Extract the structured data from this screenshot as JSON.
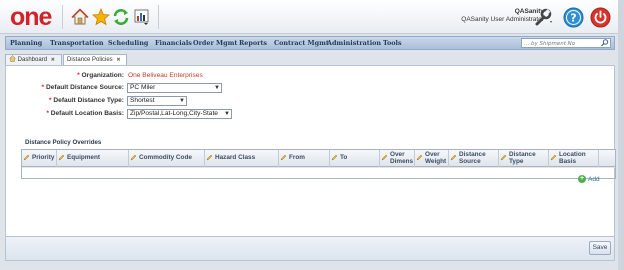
{
  "header": {
    "logo_text": "one",
    "user_name": "QASanity",
    "user_role": "QASanity User Administrator",
    "icons": [
      "home-icon",
      "star-icon",
      "refresh-icon",
      "report-icon",
      "wrench-icon",
      "help-icon",
      "power-icon"
    ]
  },
  "nav": {
    "items": [
      "Planning",
      "Transportation",
      "Scheduling",
      "Financials",
      "Order Mgmt",
      "Reports",
      "Contract Mgmt",
      "Administration",
      "Tools"
    ],
    "search_placeholder": "... by Shipment No"
  },
  "tabs": [
    {
      "label": "Dashboard"
    },
    {
      "label": "Distance Policies"
    }
  ],
  "form": {
    "organization_label": "Organization:",
    "organization_value": "One Beliveau Enterprises",
    "distance_source_label": "Default Distance Source:",
    "distance_source_value": "PC Miler",
    "distance_type_label": "Default Distance Type:",
    "distance_type_value": "Shortest",
    "location_basis_label": "Default Location Basis:",
    "location_basis_value": "Zip/Postal,Lat-Long,City-State"
  },
  "overrides": {
    "title": "Distance Policy Overrides",
    "columns": [
      "Priority",
      "Equipment",
      "Commodity Code",
      "Hazard Class",
      "From",
      "To",
      "Over Dimens",
      "Over Weight",
      "Distance Source",
      "Distance Type",
      "Location Basis"
    ],
    "add_label": "Add"
  },
  "footer": {
    "save_label": "Save"
  },
  "colors": {
    "brand_red": "#d2232a",
    "nav_bg": "#b9cce2",
    "link_blue": "#2a6fb0"
  }
}
